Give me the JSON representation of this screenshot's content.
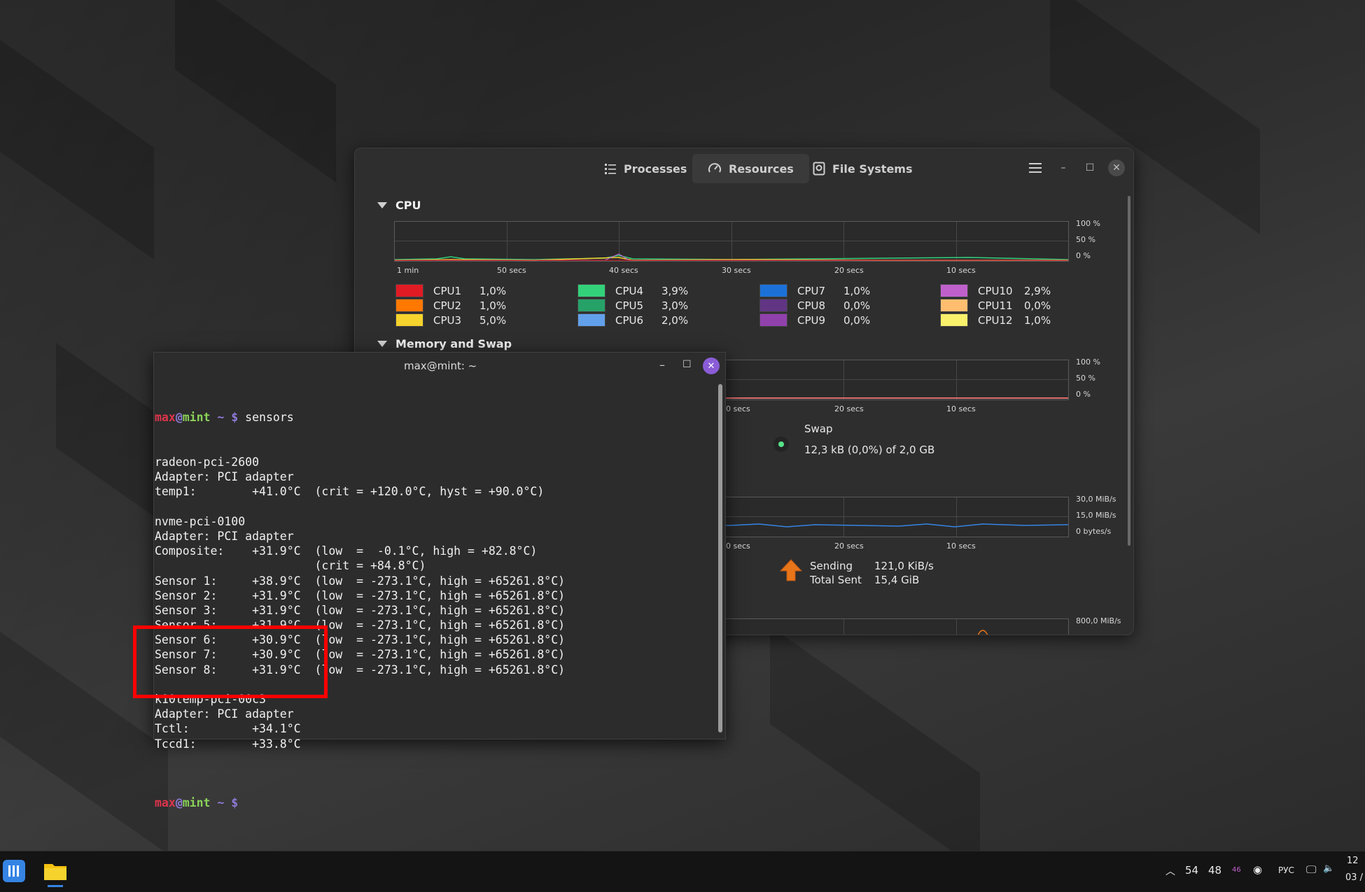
{
  "sysmon": {
    "tabs": [
      {
        "label": "Processes",
        "icon": "list-icon"
      },
      {
        "label": "Resources",
        "icon": "gauge-icon"
      },
      {
        "label": "File Systems",
        "icon": "disk-icon"
      }
    ],
    "cpu": {
      "title": "CPU",
      "y_ticks": [
        "100 %",
        "50 %",
        "0 %"
      ],
      "x_ticks": [
        "1 min",
        "50 secs",
        "40 secs",
        "30 secs",
        "20 secs",
        "10 secs"
      ],
      "legend": [
        {
          "name": "CPU1",
          "value": "1,0%",
          "color": "#e01b24"
        },
        {
          "name": "CPU2",
          "value": "1,0%",
          "color": "#ff7800"
        },
        {
          "name": "CPU3",
          "value": "5,0%",
          "color": "#f6d32d"
        },
        {
          "name": "CPU4",
          "value": "3,9%",
          "color": "#33d17a"
        },
        {
          "name": "CPU5",
          "value": "3,0%",
          "color": "#26a269"
        },
        {
          "name": "CPU6",
          "value": "2,0%",
          "color": "#62a0ea"
        },
        {
          "name": "CPU7",
          "value": "1,0%",
          "color": "#1c71d8"
        },
        {
          "name": "CPU8",
          "value": "0,0%",
          "color": "#613583"
        },
        {
          "name": "CPU9",
          "value": "0,0%",
          "color": "#9141ac"
        },
        {
          "name": "CPU10",
          "value": "2,9%",
          "color": "#c061cb"
        },
        {
          "name": "CPU11",
          "value": "0,0%",
          "color": "#ffbe6f"
        },
        {
          "name": "CPU12",
          "value": "1,0%",
          "color": "#f9f06b"
        }
      ]
    },
    "memory": {
      "title": "Memory and Swap",
      "y_ticks": [
        "100 %",
        "50 %",
        "0 %"
      ],
      "x_ticks": [
        "0 secs",
        "20 secs",
        "10 secs"
      ],
      "swap_label": "Swap",
      "swap_value": "12,3 kB (0,0%) of 2,0 GB"
    },
    "network": {
      "y_ticks": [
        "30,0 MiB/s",
        "15,0 MiB/s",
        "0 bytes/s"
      ],
      "x_ticks": [
        "0 secs",
        "20 secs",
        "10 secs"
      ],
      "sending_label": "Sending",
      "sending_value": "121,0 KiB/s",
      "total_sent_label": "Total Sent",
      "total_sent_value": "15,4 GiB"
    },
    "disk": {
      "y_tick": "800,0 MiB/s"
    }
  },
  "terminal": {
    "title": "max@mint: ~",
    "prompt": {
      "user": "max",
      "at": "@",
      "host": "mint",
      "path": " ~ $ "
    },
    "command": "sensors",
    "lines": [
      "radeon-pci-2600",
      "Adapter: PCI adapter",
      "temp1:        +41.0°C  (crit = +120.0°C, hyst = +90.0°C)",
      "",
      "nvme-pci-0100",
      "Adapter: PCI adapter",
      "Composite:    +31.9°C  (low  =  -0.1°C, high = +82.8°C)",
      "                       (crit = +84.8°C)",
      "Sensor 1:     +38.9°C  (low  = -273.1°C, high = +65261.8°C)",
      "Sensor 2:     +31.9°C  (low  = -273.1°C, high = +65261.8°C)",
      "Sensor 3:     +31.9°C  (low  = -273.1°C, high = +65261.8°C)",
      "Sensor 5:     +31.9°C  (low  = -273.1°C, high = +65261.8°C)",
      "Sensor 6:     +30.9°C  (low  = -273.1°C, high = +65261.8°C)",
      "Sensor 7:     +30.9°C  (low  = -273.1°C, high = +65261.8°C)",
      "Sensor 8:     +31.9°C  (low  = -273.1°C, high = +65261.8°C)",
      "",
      "k10temp-pci-00c3",
      "Adapter: PCI adapter",
      "Tctl:         +34.1°C",
      "Tccd1:        +33.8°C",
      ""
    ]
  },
  "taskbar": {
    "tray": {
      "num1": "54",
      "num2": "48",
      "badge": "46",
      "lang": "РУС",
      "clock_top": "12",
      "clock_bottom": "03 /"
    }
  }
}
